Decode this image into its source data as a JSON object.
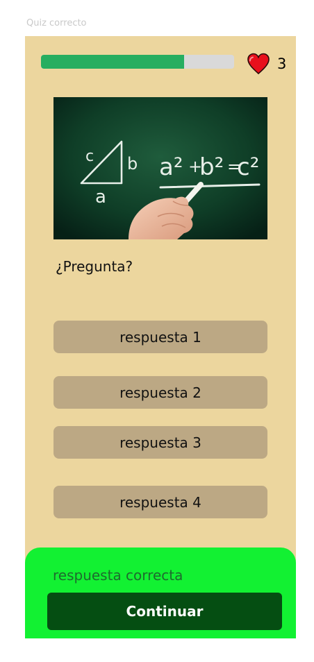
{
  "frame": {
    "label": "Quiz correcto"
  },
  "progress": {
    "value_percent": 74,
    "fill_color": "#27ae60",
    "track_color": "#d9d9d9"
  },
  "lives": {
    "count": "3",
    "icon": "heart-icon",
    "color": "#e8101c"
  },
  "question": {
    "image": "chalkboard-pythagorean-theorem",
    "chalk_text": {
      "side_c": "c",
      "side_b": "b",
      "side_a": "a",
      "a2": "a²",
      "plus": "+",
      "b2": "b²",
      "equals": "=",
      "c2": "c²"
    },
    "text": "¿Pregunta?"
  },
  "answers": [
    {
      "label": "respuesta 1"
    },
    {
      "label": "respuesta 2"
    },
    {
      "label": "respuesta 3"
    },
    {
      "label": "respuesta 4"
    }
  ],
  "feedback": {
    "message": "respuesta correcta",
    "continue_label": "Continuar",
    "panel_color": "#12f132",
    "button_color": "#054e12"
  },
  "colors": {
    "screen_background": "#ecd69e",
    "answer_button": "#bca884"
  }
}
